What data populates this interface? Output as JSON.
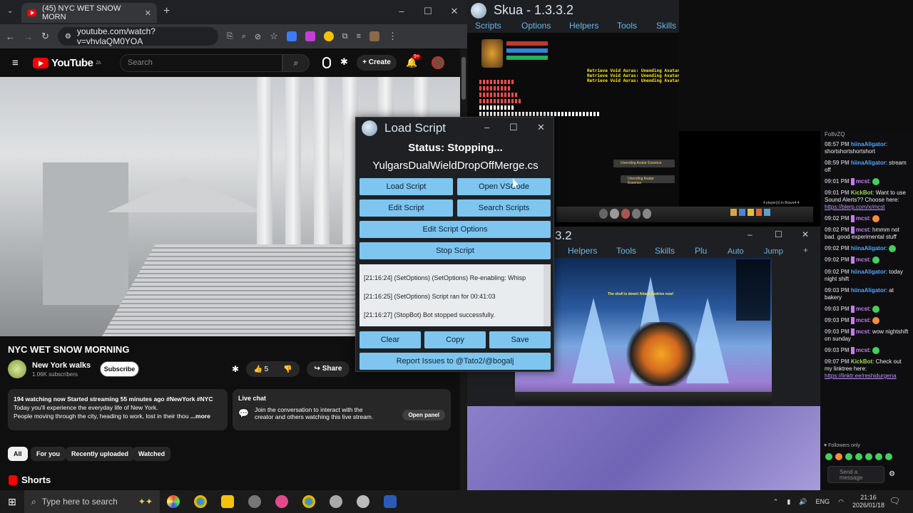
{
  "browser": {
    "tab_title": "(45) NYC WET SNOW MORN",
    "new_tab": "+",
    "url": "youtube.com/watch?v=vhvlaQM0YOA",
    "win_min": "–",
    "win_max": "☐",
    "win_close": "✕"
  },
  "youtube": {
    "logo_text": "YouTube",
    "region": "ZA",
    "search_placeholder": "Search",
    "create_label": "Create",
    "notif_count": "9+",
    "video_title": "NYC WET SNOW MORNING",
    "channel_name": "New York walks",
    "subscribers": "1.06K subscribers",
    "subscribe_label": "Subscribe",
    "likes": "5",
    "share_label": "Share",
    "desc_line1": "194 watching now  Started streaming 55 minutes ago  #NewYork #NYC",
    "desc_line2": "Today you'll experience the everyday life of New York.",
    "desc_line3": "People moving through the city, heading to work, lost in their thou",
    "more_label": "...more",
    "live_chat_title": "Live chat",
    "live_chat_text": "Join the conversation to interact with the creator and others watching this live stream.",
    "open_panel": "Open panel",
    "chips": [
      "All",
      "For you",
      "Recently uploaded",
      "Watched"
    ],
    "shorts_label": "Shorts"
  },
  "skua_main": {
    "title": "Skua - 1.3.3.2",
    "menu": [
      "Scripts",
      "Options",
      "Helpers",
      "Tools",
      "Skills"
    ],
    "aura_lines": [
      "Retrieve Void Auras: Unending Avatar Es",
      "Retrieve Void Auras: Unending Avatar Es",
      "Retrieve Void Auras: Unending Avatar Es"
    ],
    "loot1": "Unending Avatar Essence",
    "loot2": "Unending Avatar Essence",
    "players": "4 player(s) in Bravo4-4"
  },
  "skua_second": {
    "title_fragment": "3.2",
    "menu": [
      "Helpers",
      "Tools",
      "Skills",
      "Plu",
      "Auto",
      "Jump"
    ],
    "add": "+",
    "game_banner": "The shell is down!  Attack Exdrive now!"
  },
  "chat": {
    "top_user": "FoltvZQ",
    "messages": [
      {
        "time": "08:57 PM",
        "user": "hiinaAligator",
        "text": ": shortshortshortshort",
        "color": "l"
      },
      {
        "time": "08:59 PM",
        "user": "hiinaAligator",
        "text": ": stream off",
        "color": "l"
      },
      {
        "time": "09:01 PM",
        "user": "mcst",
        "text": ":",
        "color": "p",
        "emote": "g"
      },
      {
        "time": "09:01 PM",
        "user": "KickBot",
        "text": ": Want to use Sound Alerts?? Choose here:",
        "color": "g",
        "link": "https://blerp.com/x/mcst"
      },
      {
        "time": "09:02 PM",
        "user": "mcst",
        "text": ":",
        "color": "p",
        "emote": "o"
      },
      {
        "time": "09:02 PM",
        "user": "mcst",
        "text": ": hmmm not bad. good experimental stuff",
        "color": "p"
      },
      {
        "time": "09:02 PM",
        "user": "hiinaAligator",
        "text": ":",
        "color": "l",
        "emote": "g"
      },
      {
        "time": "09:02 PM",
        "user": "mcst",
        "text": ":",
        "color": "p",
        "emote": "g"
      },
      {
        "time": "09:02 PM",
        "user": "hiinaAligator",
        "text": ": today night shift",
        "color": "l"
      },
      {
        "time": "09:03 PM",
        "user": "hiinaAligator",
        "text": ": at bakery",
        "color": "l"
      },
      {
        "time": "09:03 PM",
        "user": "mcst",
        "text": ":",
        "color": "p",
        "emote": "g"
      },
      {
        "time": "09:03 PM",
        "user": "mcst",
        "text": ":",
        "color": "p",
        "emote": "o"
      },
      {
        "time": "09:03 PM",
        "user": "mcst",
        "text": ": wow nightshift on sunday",
        "color": "p"
      },
      {
        "time": "09:03 PM",
        "user": "mcst",
        "text": ":",
        "color": "p",
        "emote": "g"
      },
      {
        "time": "09:07 PM",
        "user": "KickBot",
        "text": ": Check out my linktree here:",
        "color": "g",
        "link": "https://linktr.ee/reshidurgen"
      }
    ],
    "link_suffix": "a",
    "followers_only": "Followers only",
    "send_placeholder": "Send a message"
  },
  "dialog": {
    "title": "Load Script",
    "status": "Status: Stopping...",
    "script_name": "YulgarsDualWieldDropOffMerge.cs",
    "buttons": {
      "load": "Load Script",
      "open_vscode": "Open VSCode",
      "edit": "Edit Script",
      "search": "Search Scripts",
      "edit_options": "Edit Script Options",
      "stop": "Stop Script",
      "clear": "Clear",
      "copy": "Copy",
      "save": "Save",
      "report": "Report Issues to @Tato2/@bogalj"
    },
    "log": [
      "[21:16:24] (SetOptions)  (SetOptions) Re-enabling: Whisp",
      "[21:16:25] (SetOptions)  Script ran for 00:41:03",
      "[21:16:27] (StopBot)  Bot stopped successfully."
    ]
  },
  "taskbar": {
    "search_placeholder": "Type here to search",
    "language": "ENG",
    "time": "21:16",
    "date": "2026/01/18"
  },
  "colors": {
    "accent_button": "#7ec6ef",
    "skua_menu": "#6ab7e9",
    "youtube_red": "#ff0000"
  }
}
